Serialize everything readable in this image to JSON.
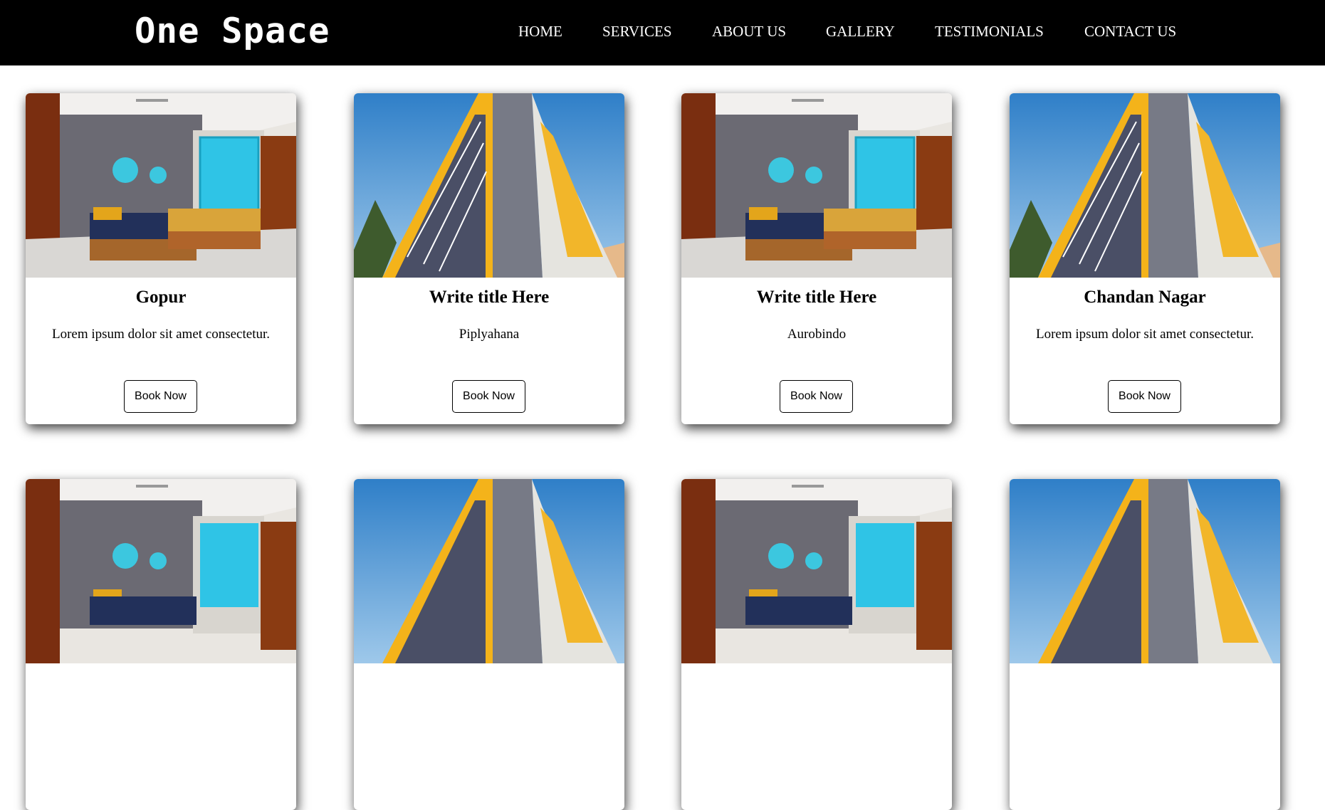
{
  "header": {
    "logo": "One Space",
    "nav": [
      "HOME",
      "SERVICES",
      "ABOUT US",
      "GALLERY",
      "TESTIMONIALS",
      "CONTACT US"
    ]
  },
  "cards": [
    {
      "title": "Gopur",
      "desc": "Lorem ipsum dolor sit amet consectetur.",
      "button": "Book Now",
      "image": "bedroom-photo"
    },
    {
      "title": "Write title Here",
      "desc": "Piplyahana",
      "button": "Book Now",
      "image": "building-photo"
    },
    {
      "title": "Write title Here",
      "desc": "Aurobindo",
      "button": "Book Now",
      "image": "bedroom-photo"
    },
    {
      "title": "Chandan Nagar",
      "desc": "Lorem ipsum dolor sit amet consectetur.",
      "button": "Book Now",
      "image": "building-photo"
    },
    {
      "title": "",
      "desc": "",
      "button": "",
      "image": "bedroom-photo"
    },
    {
      "title": "",
      "desc": "",
      "button": "",
      "image": "building-photo"
    },
    {
      "title": "",
      "desc": "",
      "button": "",
      "image": "bedroom-photo"
    },
    {
      "title": "",
      "desc": "",
      "button": "",
      "image": "building-photo"
    }
  ],
  "colors": {
    "nav_background": "#000000",
    "nav_text": "#ffffff",
    "page_background": "#ffffff"
  }
}
